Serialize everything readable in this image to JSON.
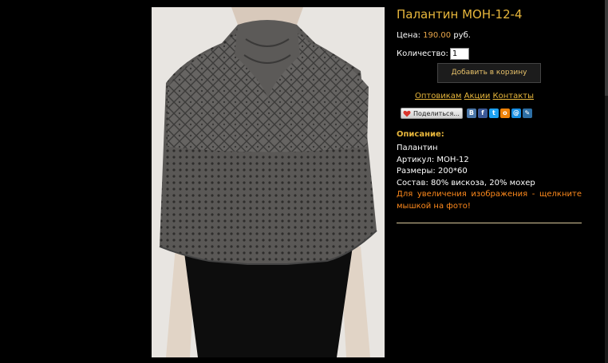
{
  "product": {
    "title": "Палантин МОН-12-4",
    "price_label": "Цена:",
    "price_value": "190.00",
    "price_currency": "руб.",
    "quantity_label": "Количество:",
    "quantity_value": "1",
    "add_to_cart_label": "Добавить в корзину"
  },
  "links": {
    "wholesale": "Оптовикам",
    "promotions": "Акции",
    "contacts": "Контакты"
  },
  "share": {
    "button_label": "Поделиться...",
    "networks": [
      {
        "name": "vkontakte-icon",
        "glyph": "В",
        "color": "#4a76a8"
      },
      {
        "name": "facebook-icon",
        "glyph": "f",
        "color": "#3b5998"
      },
      {
        "name": "twitter-icon",
        "glyph": "t",
        "color": "#1da1f2"
      },
      {
        "name": "odnoklassniki-icon",
        "glyph": "о",
        "color": "#ee8208"
      },
      {
        "name": "mailru-icon",
        "glyph": "@",
        "color": "#168de2"
      },
      {
        "name": "livejournal-icon",
        "glyph": "✎",
        "color": "#2d6fa5"
      }
    ]
  },
  "description": {
    "heading": "Описание:",
    "lines": [
      "Палантин",
      "Артикул: МОН-12",
      "Размеры: 200*60",
      "Состав: 80% вискоза, 20% мохер"
    ],
    "note": "Для увеличения изображения - щелкните мышкой на фото!"
  },
  "colors": {
    "accent": "#e8b73c",
    "price": "#e8a64a",
    "note": "#ff8a1c",
    "background": "#000000"
  }
}
